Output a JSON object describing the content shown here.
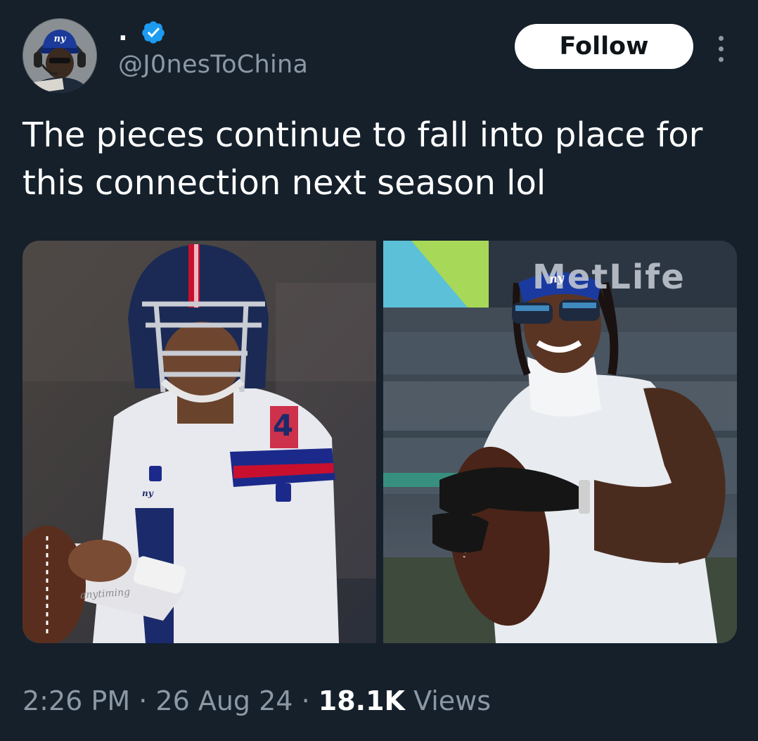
{
  "author": {
    "display_name": ".",
    "handle": "@J0nesToChina",
    "avatar_logo": "ny",
    "verified_color": "#1d9bf0",
    "verified_icon": "verified-badge-icon"
  },
  "actions": {
    "follow_label": "Follow",
    "more_icon": "more-vertical-icon"
  },
  "tweet": {
    "text": "The pieces continue to fall into place for this connection next season lol"
  },
  "media": {
    "left_image": {
      "logo": "ny",
      "jersey_number": "4",
      "watermark": "anytiming"
    },
    "right_image": {
      "headband_logo": "ny",
      "stadium_sign": "MetLife"
    }
  },
  "meta": {
    "time": "2:26 PM",
    "date": "26 Aug 24",
    "separator": "·",
    "views_count": "18.1K",
    "views_label": "Views"
  },
  "colors": {
    "background": "#15202b",
    "secondary_text": "#8b98a5",
    "giants_blue": "#1b2a6b",
    "giants_red": "#c8102e"
  }
}
